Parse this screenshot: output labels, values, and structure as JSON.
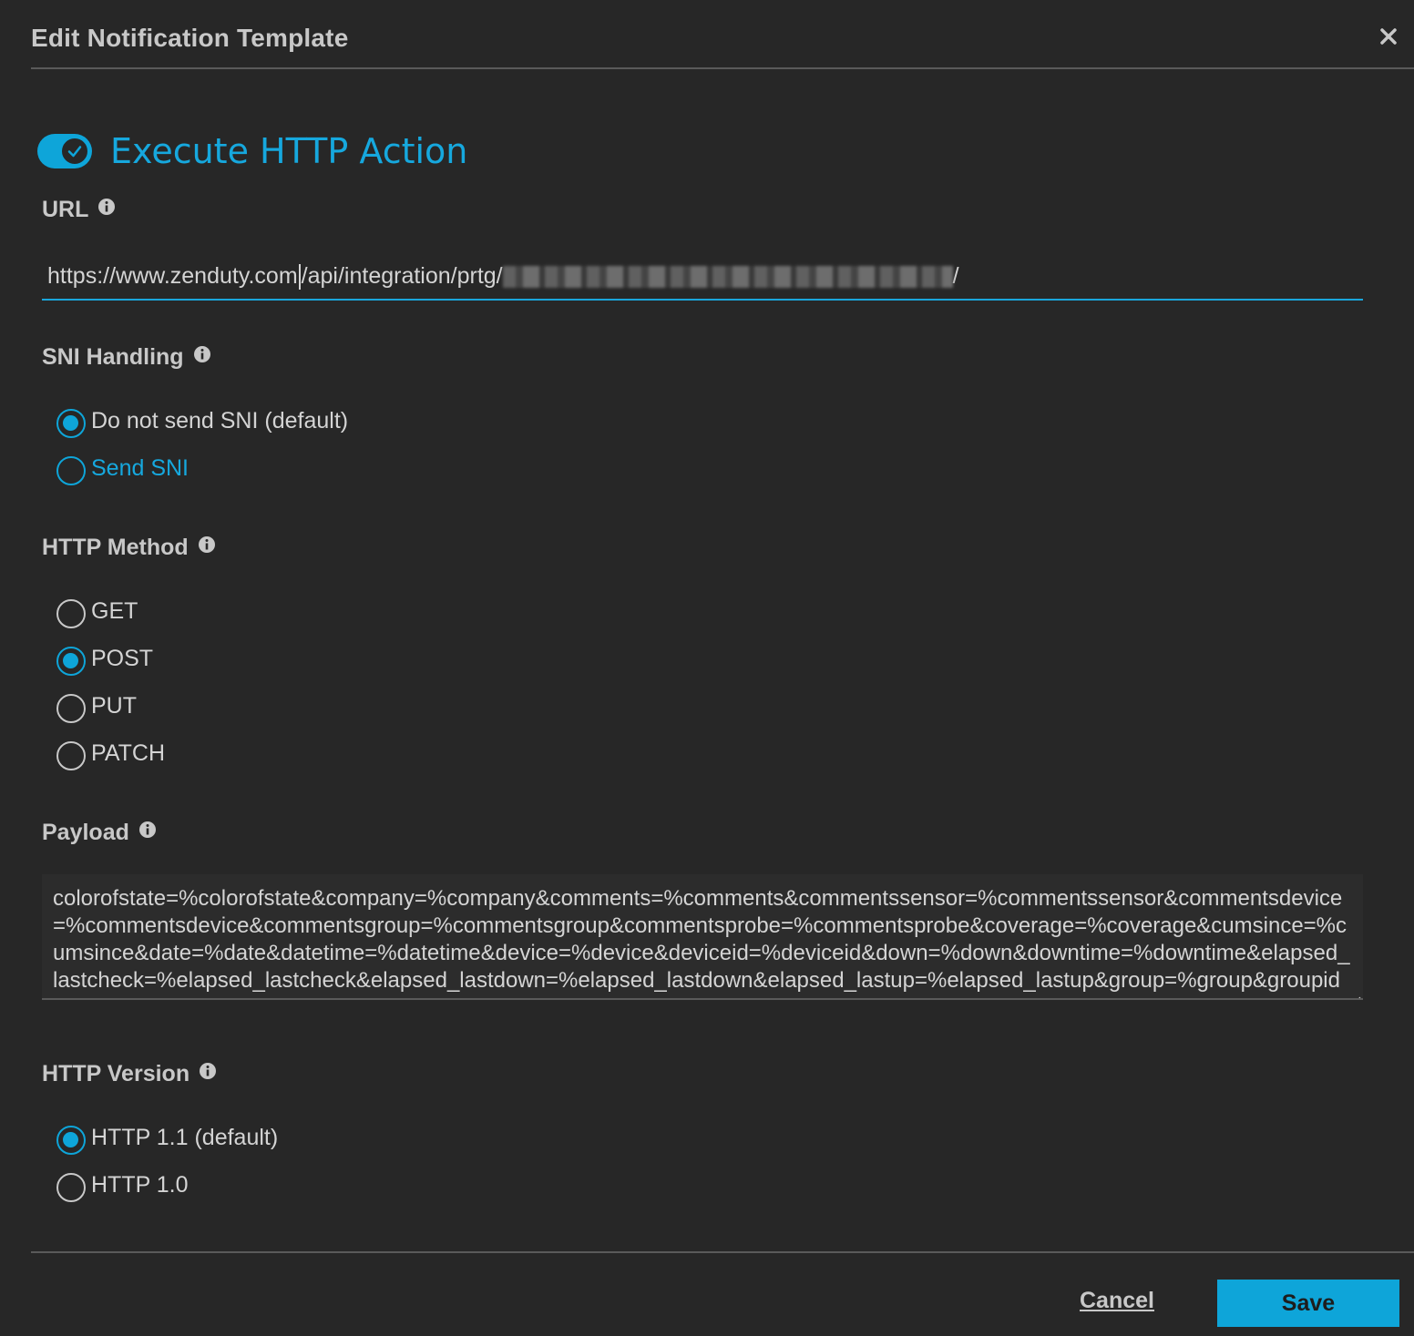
{
  "dialog": {
    "title": "Edit Notification Template",
    "close_icon": "close-icon"
  },
  "toggle": {
    "label": "Execute HTTP Action",
    "checked": true
  },
  "url": {
    "label": "URL",
    "value_before_caret": "https://www.zenduty.com",
    "value_after_caret": "/api/integration/prtg/",
    "value_trailing": "/"
  },
  "sni": {
    "label": "SNI Handling",
    "options": [
      {
        "label": "Do not send SNI (default)",
        "checked": true
      },
      {
        "label": "Send SNI",
        "checked": false
      }
    ]
  },
  "method": {
    "label": "HTTP Method",
    "options": [
      {
        "label": "GET",
        "checked": false
      },
      {
        "label": "POST",
        "checked": true
      },
      {
        "label": "PUT",
        "checked": false
      },
      {
        "label": "PATCH",
        "checked": false
      }
    ]
  },
  "payload": {
    "label": "Payload",
    "value": "colorofstate=%colorofstate&company=%company&comments=%comments&commentssensor=%commentssensor&commentsdevice=%commentsdevice&commentsgroup=%commentsgroup&commentsprobe=%commentsprobe&coverage=%coverage&cumsince=%cumsince&date=%date&datetime=%datetime&device=%device&deviceid=%deviceid&down=%down&downtime=%downtime&elapsed_lastcheck=%elapsed_lastcheck&elapsed_lastdown=%elapsed_lastdown&elapsed_lastup=%elapsed_lastup&group=%group&groupid=%groupid&history=%history&host=%host&lastcheck=%lastcheck&lastdown=%lastdown&lastup=%lastup&lastvalue=%lastvalue"
  },
  "version": {
    "label": "HTTP Version",
    "options": [
      {
        "label": "HTTP 1.1 (default)",
        "checked": true
      },
      {
        "label": "HTTP 1.0",
        "checked": false
      }
    ]
  },
  "footer": {
    "cancel_label": "Cancel",
    "save_label": "Save"
  },
  "colors": {
    "accent": "#0ea5d9",
    "background": "#272727"
  }
}
